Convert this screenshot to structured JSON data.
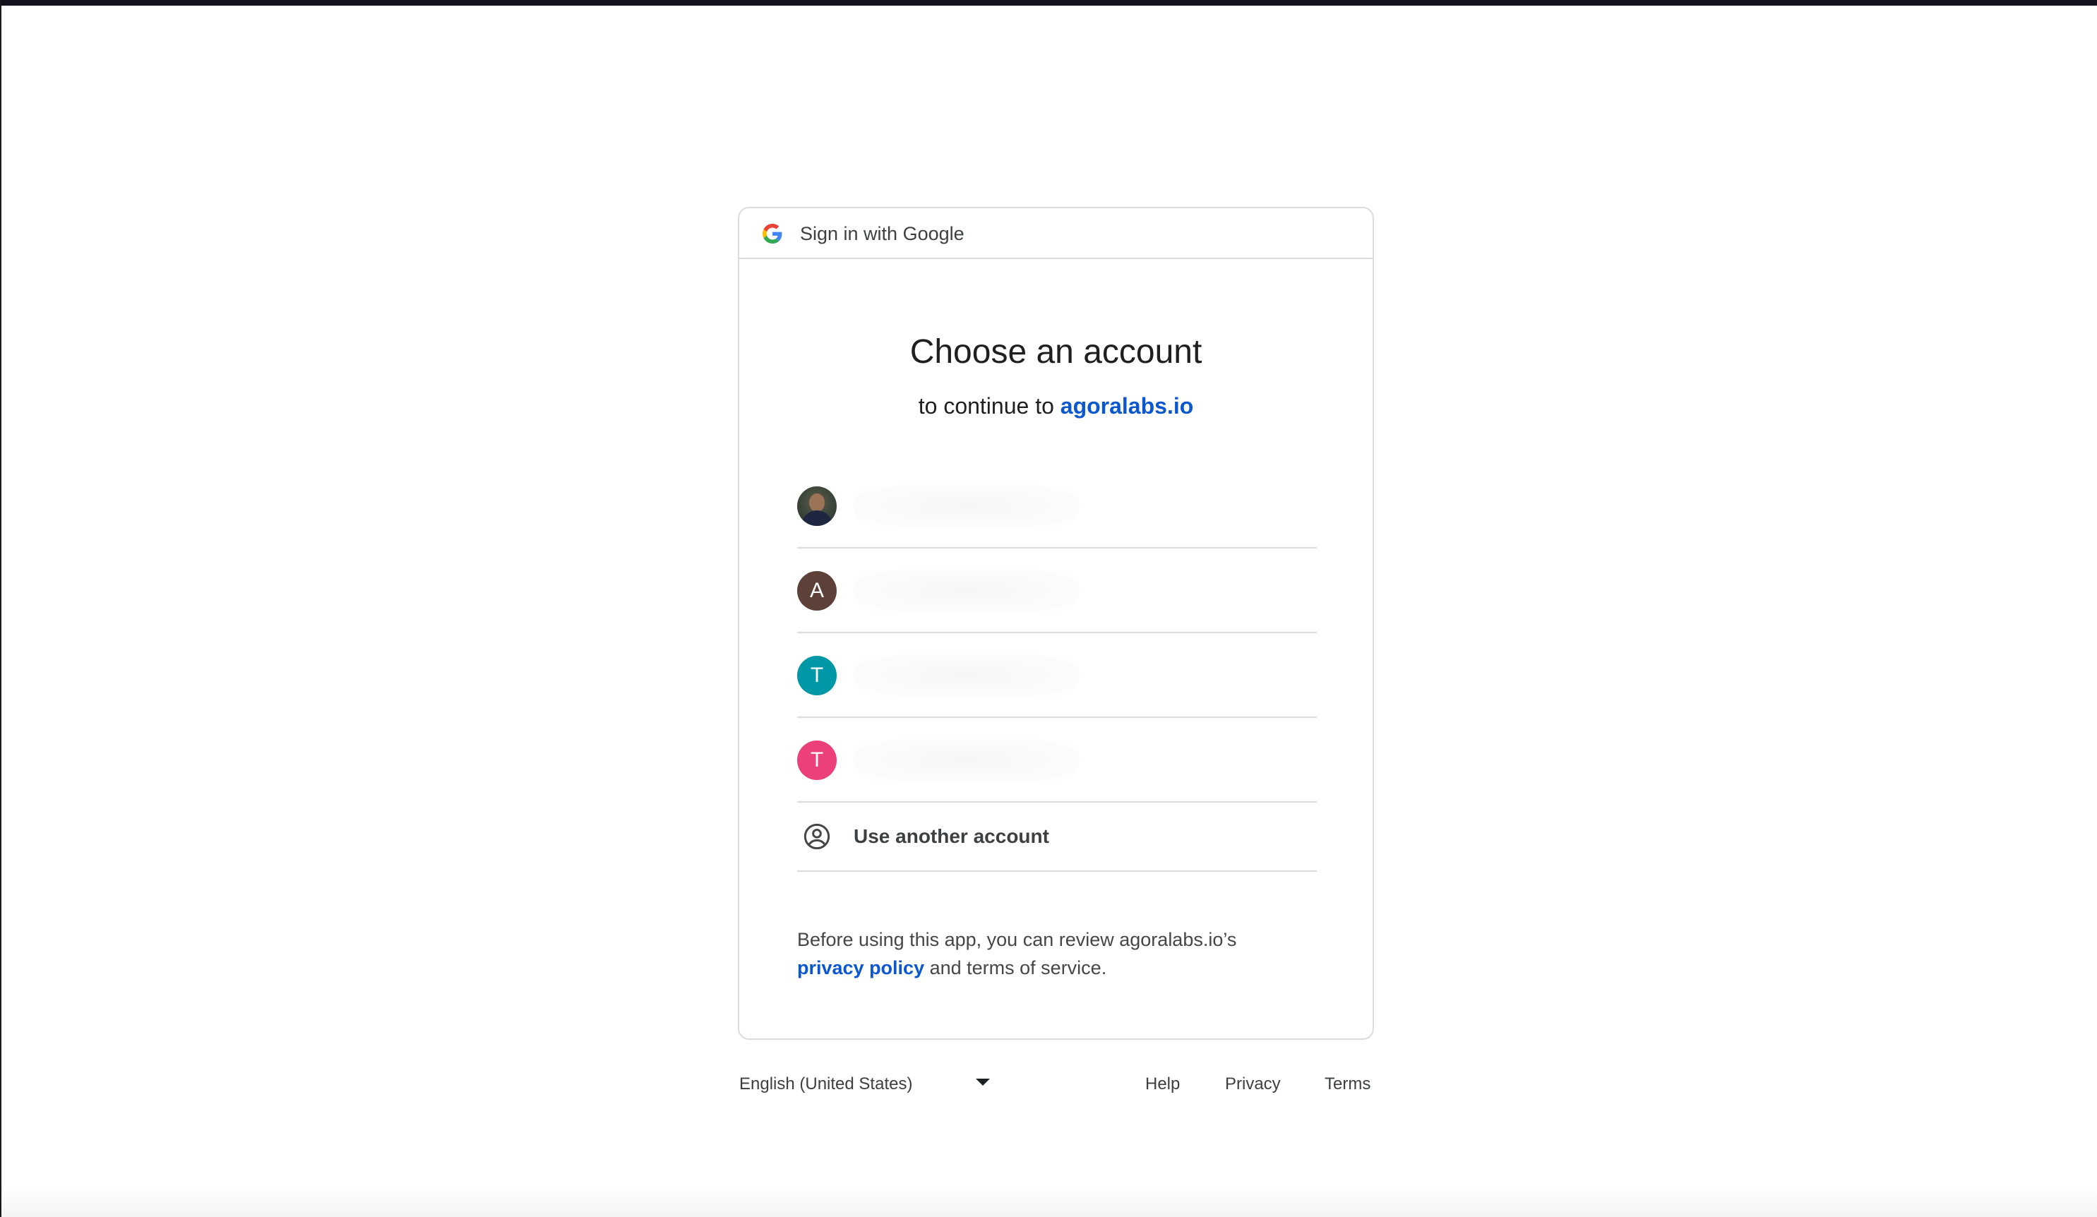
{
  "header": {
    "title": "Sign in with Google",
    "logo_icon": "google-g-icon"
  },
  "main": {
    "heading": "Choose an account",
    "subheading_prefix": "to continue to",
    "app_link": "agoralabs.io"
  },
  "accounts": [
    {
      "avatar": "photo",
      "initial": "",
      "color": "#3f4a3c"
    },
    {
      "avatar": "initial",
      "initial": "A",
      "color": "#5d4037"
    },
    {
      "avatar": "initial",
      "initial": "T",
      "color": "#0097a7"
    },
    {
      "avatar": "initial",
      "initial": "T",
      "color": "#ec407a"
    }
  ],
  "use_another": {
    "label": "Use another account",
    "icon": "account-circle-icon"
  },
  "disclaimer": {
    "text_before": "Before using this app, you can review agoralabs.io’s",
    "policy_link": "privacy policy",
    "text_after": "and terms of service."
  },
  "footer": {
    "language": "English (United States)",
    "help": "Help",
    "privacy": "Privacy",
    "terms": "Terms"
  },
  "colors": {
    "link_blue": "#0b57d0",
    "border": "#dadce0",
    "text_primary": "#1f1f1f"
  }
}
